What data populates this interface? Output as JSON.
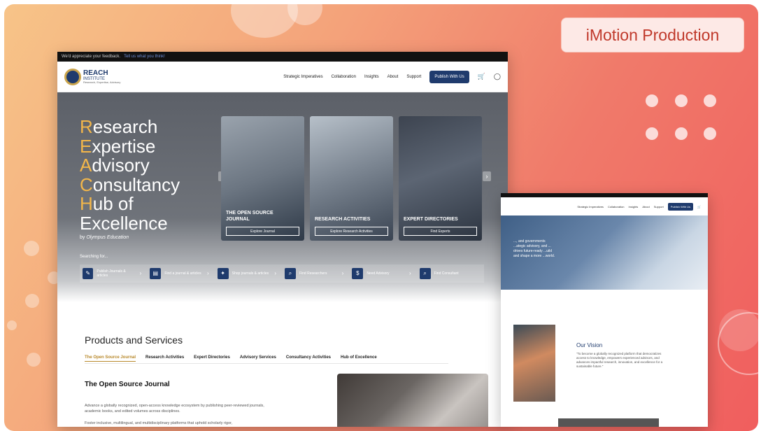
{
  "brand": {
    "badge": "iMotion Production",
    "accent": "#c0392b"
  },
  "main": {
    "topstrip": {
      "text": "We'd appreciate your feedback.",
      "link": "Tell us what you think!"
    },
    "logo": {
      "line1": "REACH",
      "line2": "INSTITUTE",
      "line3": "Research, Expertise, Advisory"
    },
    "nav": {
      "items": [
        "Strategic Imperatives",
        "Collaboration",
        "Insights",
        "About",
        "Support"
      ],
      "cta": "Publish With Us"
    },
    "hero": {
      "words": [
        {
          "cap": "R",
          "rest": "esearch"
        },
        {
          "cap": "E",
          "rest": "xpertise"
        },
        {
          "cap": "A",
          "rest": "dvisory"
        },
        {
          "cap": "C",
          "rest": "onsultancy"
        },
        {
          "cap": "H",
          "rest": "ub of"
        },
        {
          "cap": "",
          "rest": "Excellence"
        }
      ],
      "by": "by",
      "by_org": "Olympus Education",
      "searching": "Searching for...",
      "cards": [
        {
          "title": "THE OPEN SOURCE JOURNAL",
          "button": "Explore Journal"
        },
        {
          "title": "RESEARCH ACTIVITIES",
          "button": "Explore Research Activities"
        },
        {
          "title": "EXPERT DIRECTORIES",
          "button": "Find Experts"
        }
      ],
      "quick": [
        {
          "icon": "✎",
          "label": "Publish Journals & articles"
        },
        {
          "icon": "▤",
          "label": "Find a journal & articles"
        },
        {
          "icon": "✦",
          "label": "Shop journals & articles"
        },
        {
          "icon": "⌕",
          "label": "Find Researchers"
        },
        {
          "icon": "$",
          "label": "Need Advisory"
        },
        {
          "icon": "⌕",
          "label": "Find Consultant"
        }
      ]
    },
    "products": {
      "title": "Products and Services",
      "tabs": [
        "The Open Source Journal",
        "Research Activities",
        "Expert Directories",
        "Advisory Services",
        "Consultancy Activities",
        "Hub of Excellence"
      ],
      "section_title": "The Open Source Journal",
      "para1": "Advance a globally recognized, open-access knowledge ecosystem by publishing peer-reviewed journals, academic books, and edited volumes across disciplines.",
      "para2": "Foster inclusive, multilingual, and multidisciplinary platforms that uphold scholarly rigor,"
    }
  },
  "secondary": {
    "nav": [
      "Strategic Imperatives",
      "Collaboration",
      "Insights",
      "About",
      "Support"
    ],
    "cta": "Publish With Us",
    "hero_text": "..., and governments ...ategic advisory, and ... drives future-ready ...uild and shape a more ...world.",
    "vision_title": "Our Vision",
    "vision_text": "\"To become a globally recognized platform that democratizes access to knowledge, empowers experienced advisors, and advances impactful research, innovation, and excellence for a sustainable future.\""
  }
}
